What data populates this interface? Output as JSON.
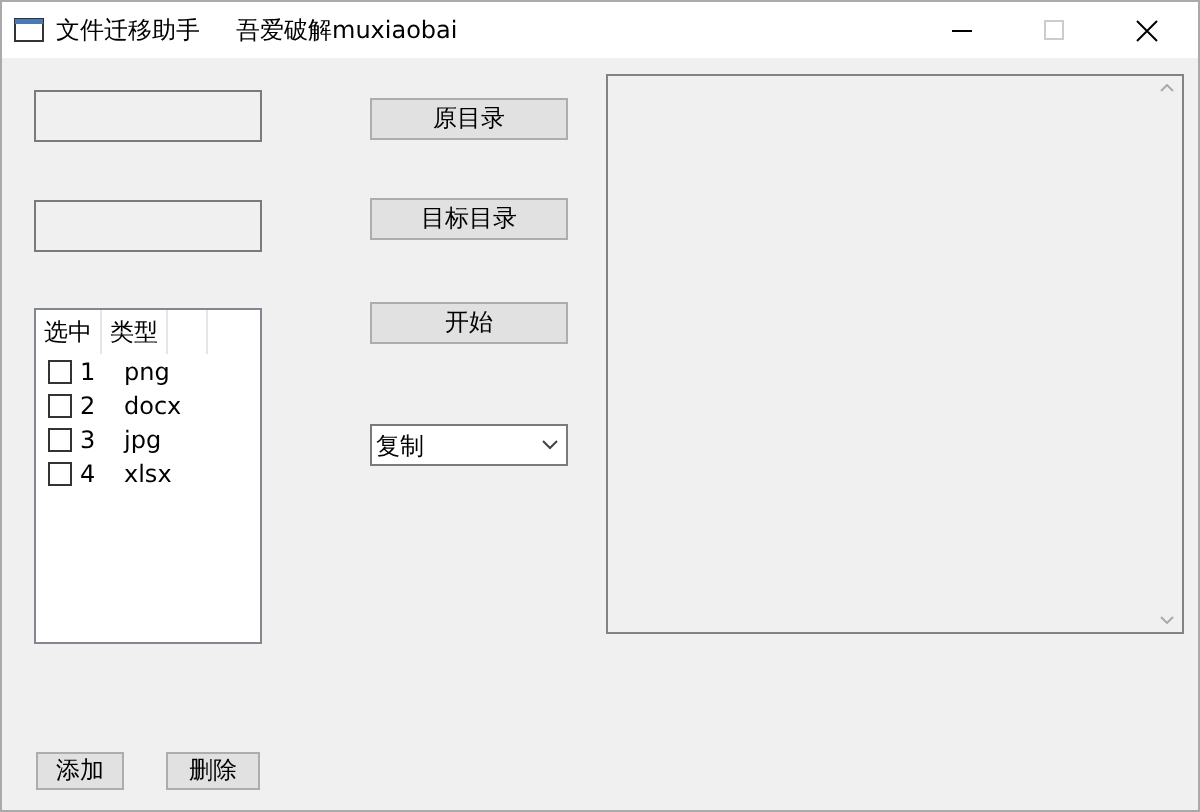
{
  "window": {
    "title": "文件迁移助手",
    "subtitle": "吾爱破解muxiaobai"
  },
  "fields": [
    {
      "kind": "textbox"
    },
    {
      "kind": "textbox"
    }
  ],
  "buttons": [
    "原目录",
    "目标目录",
    "开始"
  ],
  "file_list": {
    "columns": [
      "选中",
      "类型"
    ],
    "rows": [
      {
        "checked": false,
        "number": "1",
        "type": "png"
      },
      {
        "checked": false,
        "number": "2",
        "type": "docx"
      },
      {
        "checked": false,
        "number": "3",
        "type": "jpg"
      },
      {
        "checked": false,
        "number": "4",
        "type": "xlsx"
      }
    ]
  },
  "mode_select": {
    "value": "复制"
  },
  "bottom_buttons": [
    "添加",
    "删除"
  ]
}
